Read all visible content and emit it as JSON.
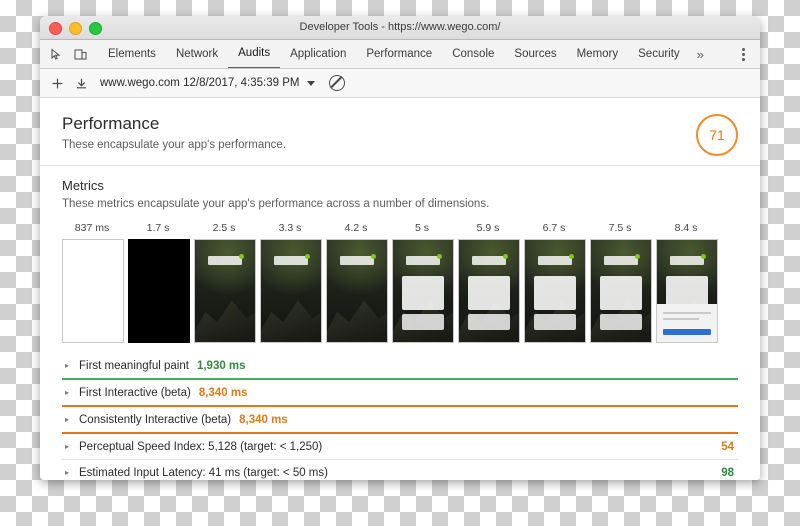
{
  "window": {
    "title": "Developer Tools - https://www.wego.com/",
    "traffic_lights": [
      "close",
      "minimize",
      "zoom"
    ]
  },
  "devtools": {
    "left_icons": [
      "inspect-icon",
      "device-toolbar-icon"
    ],
    "tabs": [
      {
        "label": "Elements",
        "active": false
      },
      {
        "label": "Network",
        "active": false
      },
      {
        "label": "Audits",
        "active": true
      },
      {
        "label": "Application",
        "active": false
      },
      {
        "label": "Performance",
        "active": false
      },
      {
        "label": "Console",
        "active": false
      },
      {
        "label": "Sources",
        "active": false
      },
      {
        "label": "Memory",
        "active": false
      },
      {
        "label": "Security",
        "active": false
      }
    ],
    "overflow_label": "»",
    "more_options": "kebab-menu-icon"
  },
  "action_bar": {
    "add_label": "+",
    "download_icon": "download-icon",
    "run_label": "www.wego.com 12/8/2017, 4:35:39 PM",
    "dropdown_icon": "chevron-down-icon",
    "clear_icon": "no-entry-icon"
  },
  "report": {
    "section_title": "Performance",
    "section_subtitle": "These encapsulate your app's performance.",
    "score": "71",
    "score_color": "#ef8b2c",
    "metrics_title": "Metrics",
    "metrics_subtitle": "These metrics encapsulate your app's performance across a number of dimensions.",
    "filmstrip": [
      {
        "label": "837 ms",
        "kind": "blank"
      },
      {
        "label": "1.7 s",
        "kind": "black"
      },
      {
        "label": "2.5 s",
        "kind": "photo"
      },
      {
        "label": "3.3 s",
        "kind": "photo"
      },
      {
        "label": "4.2 s",
        "kind": "photo"
      },
      {
        "label": "5 s",
        "kind": "photo-card"
      },
      {
        "label": "5.9 s",
        "kind": "photo-card"
      },
      {
        "label": "6.7 s",
        "kind": "photo-card"
      },
      {
        "label": "7.5 s",
        "kind": "photo-card"
      },
      {
        "label": "8.4 s",
        "kind": "photo-loaded"
      }
    ],
    "metric_rows": [
      {
        "name": "First meaningful paint",
        "value": "1,930 ms",
        "value_color": "green",
        "score": "",
        "bar": "green"
      },
      {
        "name": "First Interactive (beta)",
        "value": "8,340 ms",
        "value_color": "orange",
        "score": "",
        "bar": "orange"
      },
      {
        "name": "Consistently Interactive (beta)",
        "value": "8,340 ms",
        "value_color": "orange",
        "score": "",
        "bar": "orange"
      },
      {
        "name": "Perceptual Speed Index: 5,128 (target: < 1,250)",
        "value": "",
        "value_color": "",
        "score": "54",
        "score_color": "orange",
        "bar": "grey"
      },
      {
        "name": "Estimated Input Latency: 41 ms (target: < 50 ms)",
        "value": "",
        "value_color": "",
        "score": "98",
        "score_color": "green",
        "bar": "grey"
      }
    ],
    "expand_arrow": "▸"
  }
}
